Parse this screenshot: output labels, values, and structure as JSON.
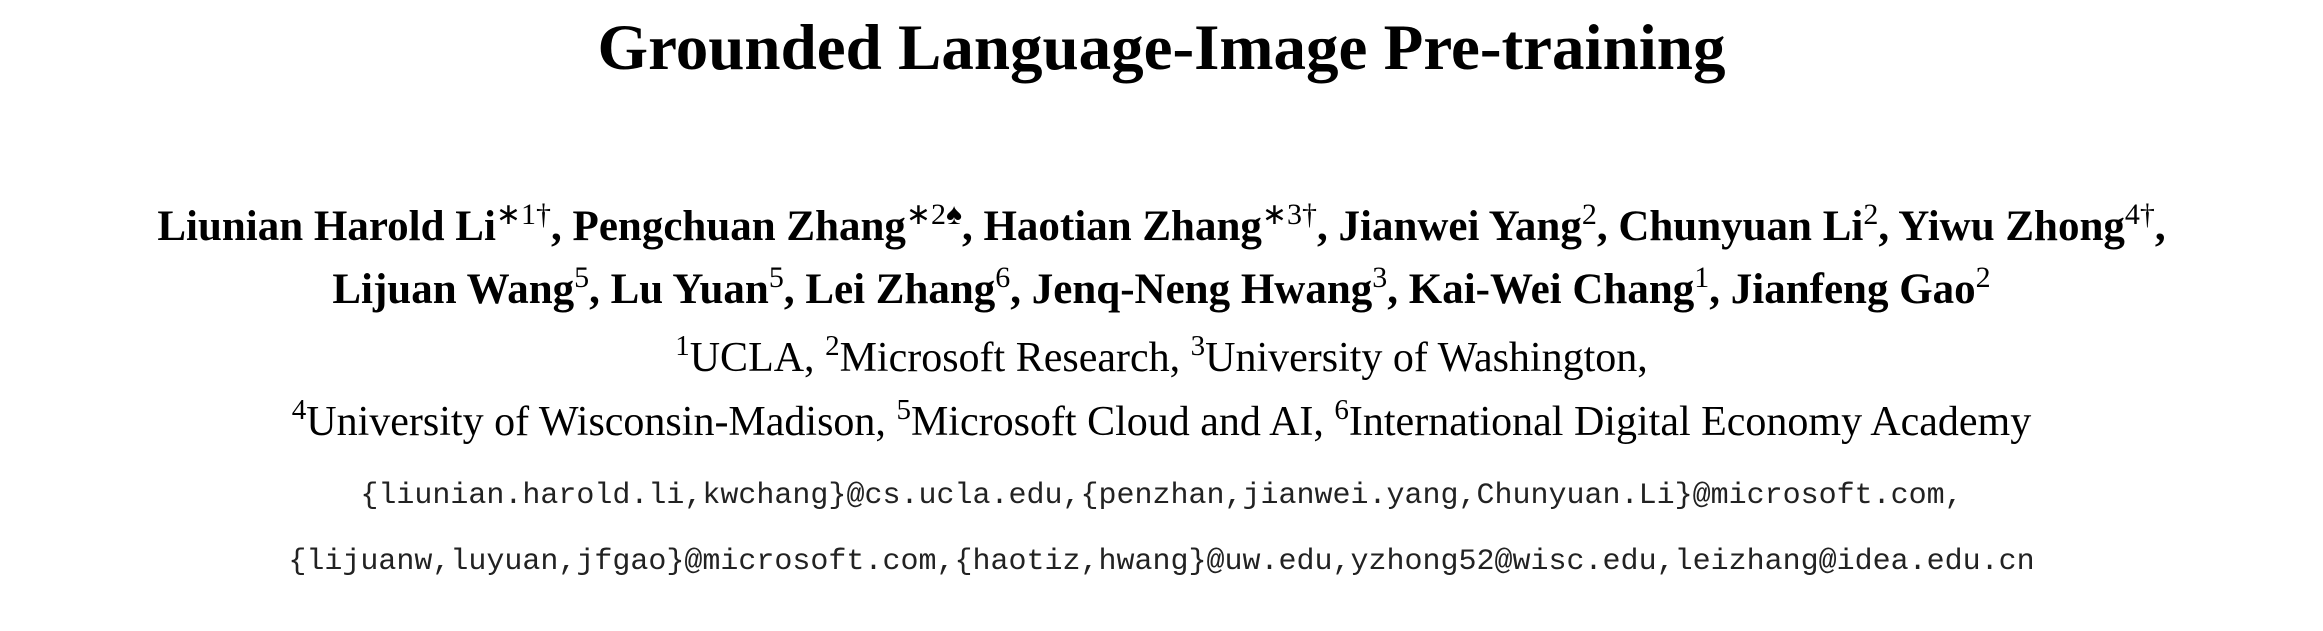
{
  "title": "Grounded Language-Image Pre-training",
  "authors": {
    "line1": [
      {
        "name": "Liunian Harold Li",
        "sup": "∗1†",
        "sep": ", "
      },
      {
        "name": "Pengchuan Zhang",
        "sup": "∗2♠",
        "sep": ", "
      },
      {
        "name": "Haotian Zhang",
        "sup": "∗3†",
        "sep": ", "
      },
      {
        "name": "Jianwei Yang",
        "sup": "2",
        "sep": ", "
      },
      {
        "name": "Chunyuan Li",
        "sup": "2",
        "sep": ", "
      },
      {
        "name": "Yiwu Zhong",
        "sup": "4†",
        "sep": ","
      }
    ],
    "line2": [
      {
        "name": "Lijuan Wang",
        "sup": "5",
        "sep": ", "
      },
      {
        "name": "Lu Yuan",
        "sup": "5",
        "sep": ", "
      },
      {
        "name": "Lei Zhang",
        "sup": "6",
        "sep": ", "
      },
      {
        "name": "Jenq-Neng Hwang",
        "sup": "3",
        "sep": ", "
      },
      {
        "name": "Kai-Wei Chang",
        "sup": "1",
        "sep": ", "
      },
      {
        "name": "Jianfeng Gao",
        "sup": "2",
        "sep": ""
      }
    ]
  },
  "affiliations": {
    "line1": [
      {
        "sup": "1",
        "text": "UCLA, "
      },
      {
        "sup": "2",
        "text": "Microsoft Research, "
      },
      {
        "sup": "3",
        "text": "University of Washington,"
      }
    ],
    "line2": [
      {
        "sup": "4",
        "text": "University of Wisconsin-Madison, "
      },
      {
        "sup": "5",
        "text": "Microsoft Cloud and AI, "
      },
      {
        "sup": "6",
        "text": "International Digital Economy Academy"
      }
    ]
  },
  "emails": {
    "line1": "{liunian.harold.li,kwchang}@cs.ucla.edu,{penzhan,jianwei.yang,Chunyuan.Li}@microsoft.com,",
    "line2": "{lijuanw,luyuan,jfgao}@microsoft.com,{haotiz,hwang}@uw.edu,yzhong52@wisc.edu,leizhang@idea.edu.cn"
  }
}
